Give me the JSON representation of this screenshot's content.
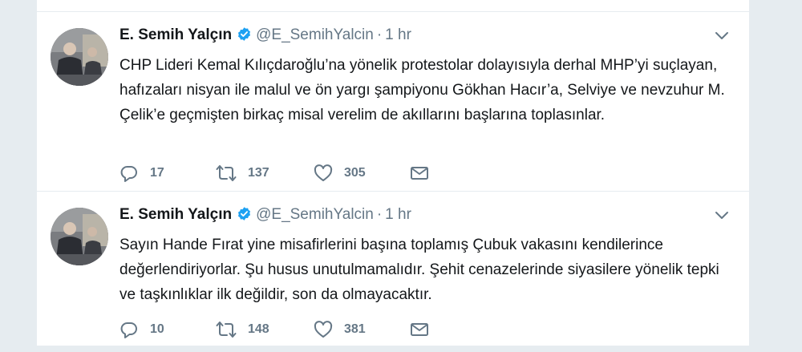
{
  "colors": {
    "background": "#e6ecf0",
    "card": "#ffffff",
    "text": "#14171a",
    "muted": "#657786",
    "verified": "#1da1f2"
  },
  "tweets": [
    {
      "author_name": "E. Semih Yalçın",
      "verified": true,
      "handle": "@E_SemihYalcin",
      "separator": "·",
      "time": "1 hr",
      "text": "CHP Lideri Kemal Kılıçdaroğlu’na yönelik protestolar dolayısıyla derhal MHP’yi suçlayan, hafızaları nisyan ile malul ve ön yargı şampiyonu Gökhan Hacır’a, Selviye ve nevzuhur M. Çelik’e geçmişten birkaç misal verelim de akıllarını başlarına toplasınlar.",
      "replies": "17",
      "retweets": "137",
      "likes": "305",
      "icons": [
        "reply-icon",
        "retweet-icon",
        "like-icon",
        "direct-message-icon",
        "chevron-down-icon",
        "verified-badge-icon"
      ]
    },
    {
      "author_name": "E. Semih Yalçın",
      "verified": true,
      "handle": "@E_SemihYalcin",
      "separator": "·",
      "time": "1 hr",
      "text": "Sayın Hande Fırat yine misafirlerini başına toplamış Çubuk vakasını kendilerince değerlendiriyorlar. Şu husus unutulmamalıdır. Şehit cenazelerinde siyasilere yönelik tepki ve taşkınlıklar ilk değildir, son da olmayacaktır.",
      "replies": "10",
      "retweets": "148",
      "likes": "381",
      "icons": [
        "reply-icon",
        "retweet-icon",
        "like-icon",
        "direct-message-icon",
        "chevron-down-icon",
        "verified-badge-icon"
      ]
    }
  ]
}
